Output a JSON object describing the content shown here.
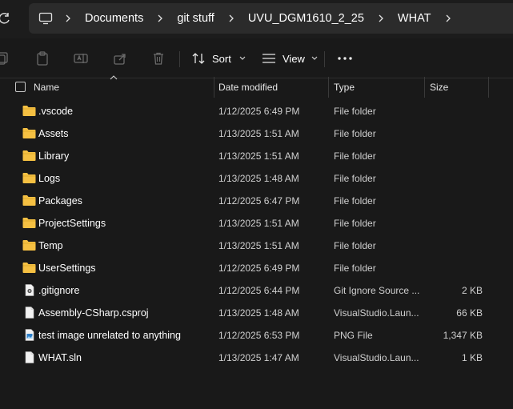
{
  "breadcrumbs": [
    "Documents",
    "git stuff",
    "UVU_DGM1610_2_25",
    "WHAT"
  ],
  "toolbar": {
    "sort_label": "Sort",
    "view_label": "View"
  },
  "columns": {
    "name": "Name",
    "date": "Date modified",
    "type": "Type",
    "size": "Size"
  },
  "files": [
    {
      "name": ".vscode",
      "date": "1/12/2025 6:49 PM",
      "type": "File folder",
      "size": "",
      "icon": "folder-icon"
    },
    {
      "name": "Assets",
      "date": "1/13/2025 1:51 AM",
      "type": "File folder",
      "size": "",
      "icon": "folder-icon"
    },
    {
      "name": "Library",
      "date": "1/13/2025 1:51 AM",
      "type": "File folder",
      "size": "",
      "icon": "folder-icon"
    },
    {
      "name": "Logs",
      "date": "1/13/2025 1:48 AM",
      "type": "File folder",
      "size": "",
      "icon": "folder-icon"
    },
    {
      "name": "Packages",
      "date": "1/12/2025 6:47 PM",
      "type": "File folder",
      "size": "",
      "icon": "folder-icon"
    },
    {
      "name": "ProjectSettings",
      "date": "1/13/2025 1:51 AM",
      "type": "File folder",
      "size": "",
      "icon": "folder-icon"
    },
    {
      "name": "Temp",
      "date": "1/13/2025 1:51 AM",
      "type": "File folder",
      "size": "",
      "icon": "folder-icon"
    },
    {
      "name": "UserSettings",
      "date": "1/12/2025 6:49 PM",
      "type": "File folder",
      "size": "",
      "icon": "folder-icon"
    },
    {
      "name": ".gitignore",
      "date": "1/12/2025 6:44 PM",
      "type": "Git Ignore Source ...",
      "size": "2 KB",
      "icon": "gitignore-file-icon"
    },
    {
      "name": "Assembly-CSharp.csproj",
      "date": "1/13/2025 1:48 AM",
      "type": "VisualStudio.Laun...",
      "size": "66 KB",
      "icon": "blank-file-icon"
    },
    {
      "name": "test image unrelated to anything",
      "date": "1/12/2025 6:53 PM",
      "type": "PNG File",
      "size": "1,347 KB",
      "icon": "image-file-icon"
    },
    {
      "name": "WHAT.sln",
      "date": "1/13/2025 1:47 AM",
      "type": "VisualStudio.Laun...",
      "size": "1 KB",
      "icon": "blank-file-icon"
    }
  ],
  "colors": {
    "background": "#191919",
    "folder": "#f5c042",
    "address_box": "#2b2b2b"
  }
}
